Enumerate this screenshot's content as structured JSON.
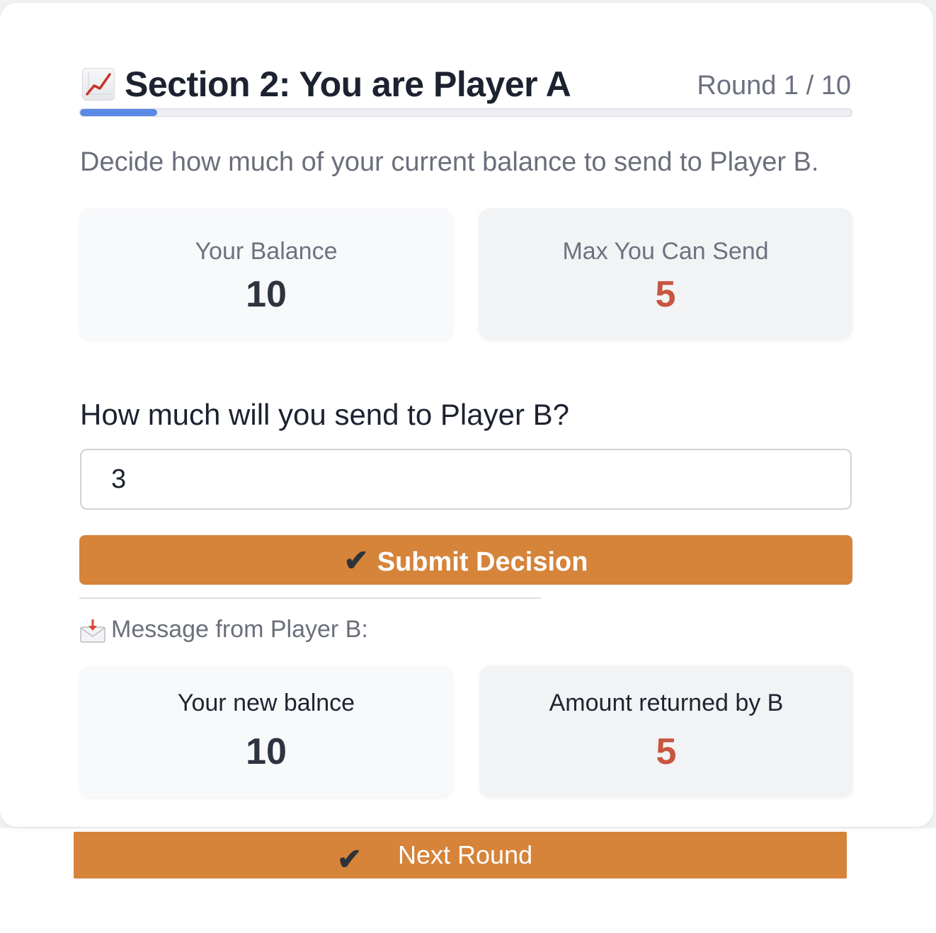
{
  "header": {
    "icon": "chart-increasing-icon",
    "title": "Section 2: You are Player A",
    "round": "Round 1 / 10",
    "progress_fraction": 0.1
  },
  "intro": "Decide how much of your current balance to send to Player B.",
  "stats": {
    "balance_label": "Your Balance",
    "balance_value": "10",
    "max_label": "Max You Can Send",
    "max_value": "5"
  },
  "question": "How much will you send to Player B?",
  "send_input": {
    "value": "3"
  },
  "submit_button": {
    "check": "✔",
    "label": "Submit Decision"
  },
  "message": {
    "icon": "incoming-envelope-icon",
    "label": "Message from Player B:"
  },
  "result": {
    "new_balance_label": "Your new balnce",
    "new_balance_value": "10",
    "returned_label": "Amount returned by B",
    "returned_value": "5"
  },
  "next_button": {
    "check": "✔",
    "label": "Next Round"
  },
  "colors": {
    "accent": "#d5843a",
    "progress": "#5b8ae6",
    "highlight_value": "#c8553f"
  }
}
